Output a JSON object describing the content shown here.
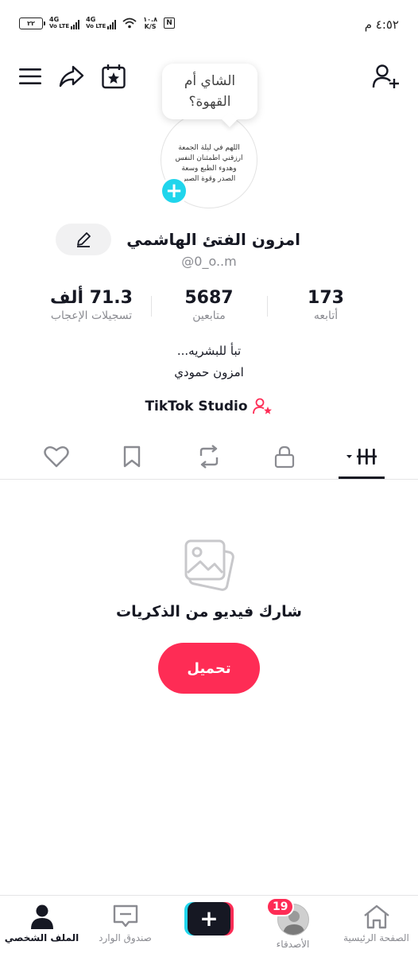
{
  "status_bar": {
    "battery": "٢٢",
    "network1": "4G",
    "network1_sub": "Vo LTE",
    "network2": "4G",
    "network2_sub": "Vo LTE",
    "speed_value": "١٠.٨",
    "speed_unit": "K/S",
    "nfc": "N",
    "time": "٤:٥٢ م"
  },
  "top_bar": {
    "menu_icon": "hamburger-menu-icon",
    "share_icon": "share-icon",
    "calendar_icon": "calendar-star-icon",
    "add_friend_icon": "add-friend-icon"
  },
  "bubble": {
    "text": "الشاي أم القهوة؟"
  },
  "avatar": {
    "text": "اللهم في ليلة الجمعة ارزقني اطمئنان النفس وهدوء الطبع وسعة الصدر وقوة الصبر"
  },
  "profile": {
    "name": "امزون الفتئ الهاشمي",
    "handle": "@0_o..m"
  },
  "stats": {
    "following": {
      "value": "173",
      "label": "أتابعه"
    },
    "followers": {
      "value": "5687",
      "label": "متابعين"
    },
    "likes": {
      "value": "71.3 ألف",
      "label": "تسجيلات الإعجاب"
    }
  },
  "bio": {
    "line1": "تبأ للبشريه...",
    "line2": "امزون حمودي"
  },
  "studio": {
    "label": "TikTok Studio"
  },
  "tabs": [
    {
      "name": "videos",
      "icon": "grid-icon",
      "active": true
    },
    {
      "name": "private",
      "icon": "lock-icon"
    },
    {
      "name": "reposts",
      "icon": "repost-icon"
    },
    {
      "name": "favorites",
      "icon": "bookmark-icon"
    },
    {
      "name": "liked",
      "icon": "heart-icon"
    }
  ],
  "empty_state": {
    "title": "شارك فيديو من الذكريات",
    "button": "تحميل"
  },
  "bottom_nav": {
    "home": "الصفحة الرئيسية",
    "friends": "الأصدقاء",
    "friends_badge": "19",
    "inbox": "صندوق الوارد",
    "profile": "الملف الشخصي"
  },
  "colors": {
    "accent": "#fe2c55",
    "cyan": "#20d5ec",
    "text": "#161823",
    "secondary_text": "#8a8b91"
  }
}
